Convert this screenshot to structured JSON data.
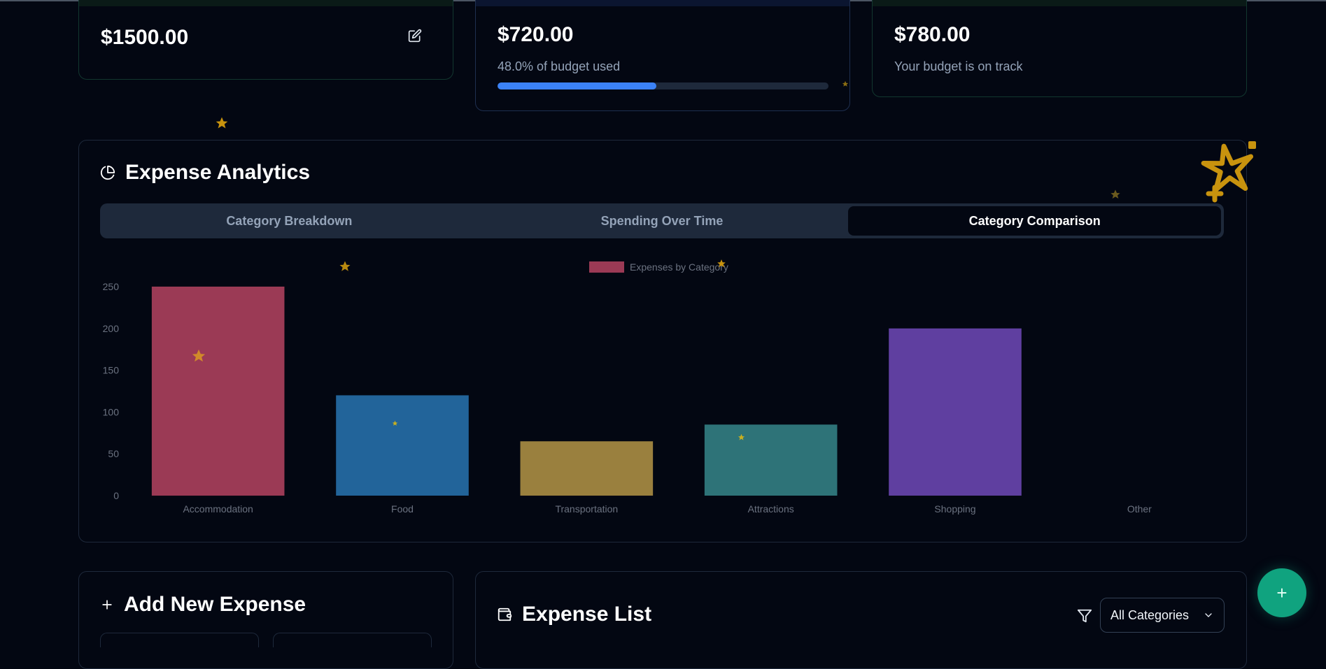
{
  "budget_card": {
    "amount": "$1500.00"
  },
  "spent_card": {
    "amount": "$720.00",
    "subtitle": "48.0% of budget used",
    "progress_fraction": 0.48
  },
  "remaining_card": {
    "amount": "$780.00",
    "subtitle": "Your budget is on track"
  },
  "analytics": {
    "title": "Expense Analytics",
    "tabs": [
      {
        "label": "Category Breakdown",
        "active": false
      },
      {
        "label": "Spending Over Time",
        "active": false
      },
      {
        "label": "Category Comparison",
        "active": true
      }
    ]
  },
  "chart_data": {
    "type": "bar",
    "categories": [
      "Accommodation",
      "Food",
      "Transportation",
      "Attractions",
      "Shopping",
      "Other"
    ],
    "values": [
      250,
      120,
      65,
      85,
      200,
      0
    ],
    "legend": [
      "Expenses by Category"
    ],
    "legend_placement": "top-center",
    "ylim": [
      0,
      250
    ],
    "yticks": [
      "0",
      "50",
      "100",
      "150",
      "200",
      "250"
    ],
    "grid": false,
    "colors": [
      "#9b3a55",
      "#22649a",
      "#9a803e",
      "#2e7378",
      "#5f3fa0",
      "#475569"
    ],
    "legend_color": "#9b3a55"
  },
  "add_expense": {
    "title": "Add New Expense"
  },
  "expense_list": {
    "title": "Expense List",
    "filter_value": "All Categories"
  },
  "fab": {
    "label": "+"
  },
  "colors": {
    "background": "#030712",
    "accent_blue": "#3b82f6",
    "accent_green": "#10a37f",
    "star_gold": "#d4a017"
  }
}
